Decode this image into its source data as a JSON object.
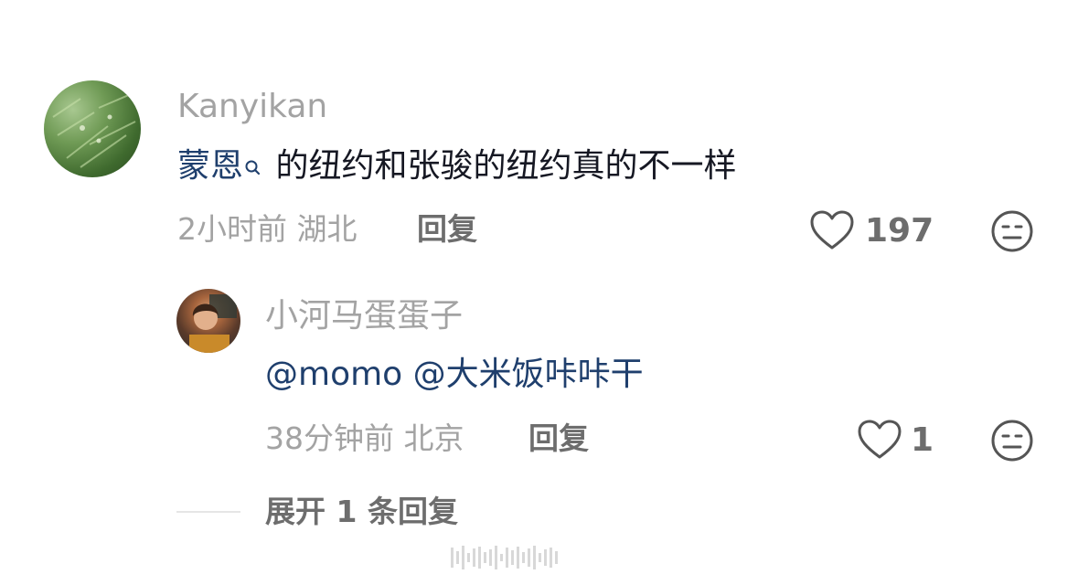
{
  "comment": {
    "username": "Kanyikan",
    "text_link": "蒙恩",
    "text_rest": " 的纽约和张骏的纽约真的不一样",
    "time": "2小时前",
    "location": "湖北",
    "reply_label": "回复",
    "like_count": "197",
    "icons": {
      "search": "search-icon",
      "like": "heart-icon",
      "dislike": "unhappy-face-icon"
    }
  },
  "reply": {
    "username": "小河马蛋蛋子",
    "mention1": "@momo",
    "mention2": "@大米饭咔咔干",
    "time": "38分钟前",
    "location": "北京",
    "reply_label": "回复",
    "like_count": "1",
    "icons": {
      "like": "heart-icon",
      "dislike": "unhappy-face-icon"
    }
  },
  "expand": {
    "label": "展开 1 条回复"
  },
  "colors": {
    "link": "#1f3f6d",
    "text": "#161823",
    "meta": "#a3a3a3",
    "action": "#6d6d6d"
  }
}
